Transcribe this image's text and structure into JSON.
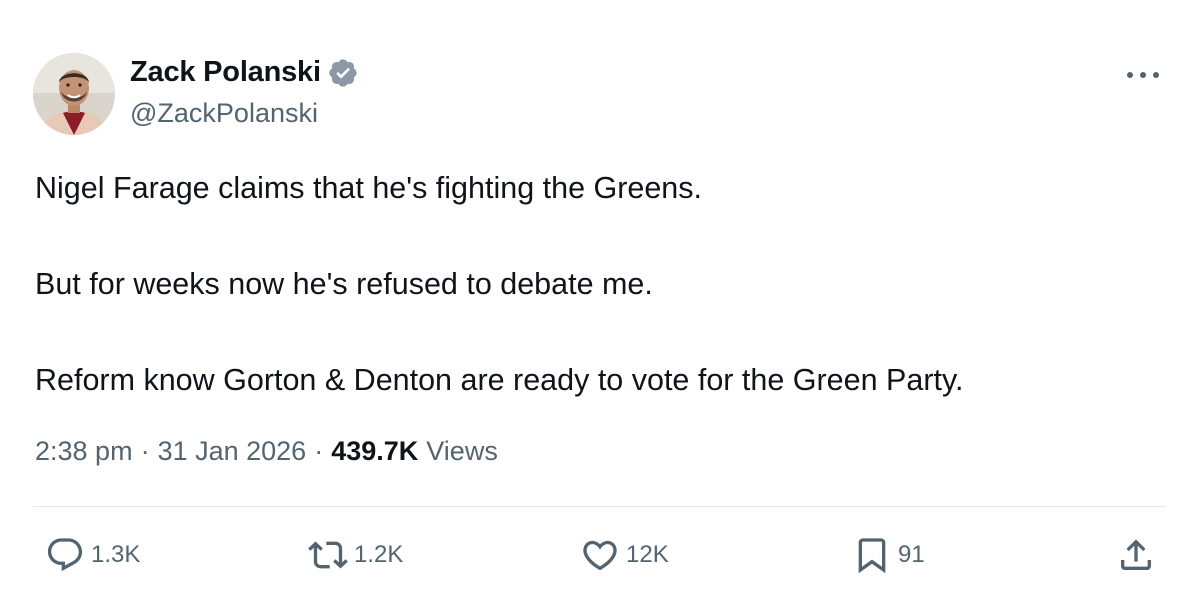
{
  "author": {
    "name": "Zack Polanski",
    "handle": "@ZackPolanski",
    "verified": true,
    "avatar_icon": "profile-photo"
  },
  "tweet": {
    "paragraphs": [
      "Nigel Farage claims that he's fighting the Greens.",
      "But for weeks now he's refused to debate me.",
      "Reform know Gorton & Denton are ready to vote for the Green Party."
    ]
  },
  "meta": {
    "time": "2:38 pm",
    "separator": "·",
    "date": "31 Jan 2026",
    "views_count": "439.7K",
    "views_label": "Views"
  },
  "actions": {
    "reply": {
      "icon": "reply-icon",
      "count": "1.3K"
    },
    "retweet": {
      "icon": "retweet-icon",
      "count": "1.2K"
    },
    "like": {
      "icon": "heart-icon",
      "count": "12K"
    },
    "bookmark": {
      "icon": "bookmark-icon",
      "count": "91"
    },
    "share": {
      "icon": "share-icon"
    }
  },
  "colors": {
    "text_primary": "#0f1419",
    "text_secondary": "#536471",
    "verified_badge": "#8b98a5",
    "divider": "#e1e6ea"
  }
}
